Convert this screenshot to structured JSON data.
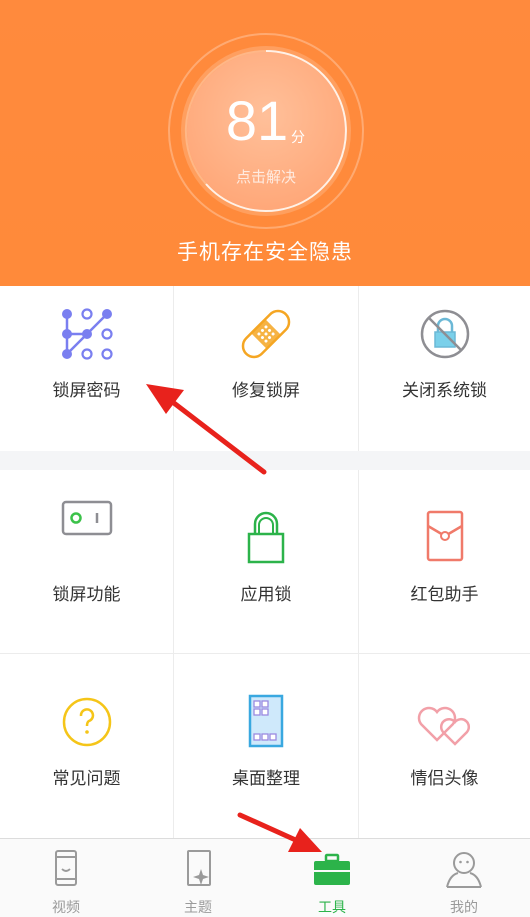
{
  "header": {
    "score": "81",
    "score_unit": "分",
    "action": "点击解决",
    "status": "手机存在安全隐患"
  },
  "tools_primary": [
    {
      "label": "锁屏密码",
      "icon": "pattern-lock-icon"
    },
    {
      "label": "修复锁屏",
      "icon": "bandage-icon"
    },
    {
      "label": "关闭系统锁",
      "icon": "disable-lock-icon"
    }
  ],
  "tools_secondary": [
    {
      "label": "锁屏功能",
      "icon": "switch-icon"
    },
    {
      "label": "应用锁",
      "icon": "padlock-icon"
    },
    {
      "label": "红包助手",
      "icon": "red-envelope-icon"
    },
    {
      "label": "常见问题",
      "icon": "question-icon"
    },
    {
      "label": "桌面整理",
      "icon": "desktop-grid-icon"
    },
    {
      "label": "情侣头像",
      "icon": "hearts-icon"
    }
  ],
  "tabbar": {
    "items": [
      {
        "label": "视频",
        "icon": "video-phone-icon"
      },
      {
        "label": "主题",
        "icon": "theme-icon"
      },
      {
        "label": "工具",
        "icon": "toolbox-icon"
      },
      {
        "label": "我的",
        "icon": "profile-icon"
      }
    ],
    "active_index": 2
  },
  "colors": {
    "header_orange": "#ff8a3a",
    "active_green": "#2cb34a",
    "annotation_red": "#e8221c"
  }
}
